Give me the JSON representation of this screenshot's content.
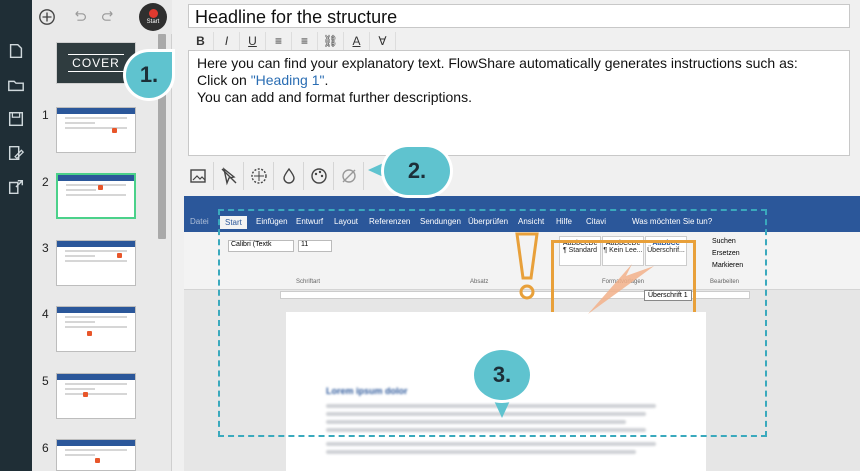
{
  "headline": {
    "value": "Headline for the structure"
  },
  "format_bar": [
    "B",
    "I",
    "U",
    "≡",
    "≡",
    "⛓",
    "A",
    "∀"
  ],
  "description": {
    "line1": "Here you can find your explanatory text. FlowShare automatically generates instructions such as:",
    "line2_prefix": "Click on ",
    "line2_link": "\"Heading 1\"",
    "line2_suffix": ".",
    "line3": "You can add and format further descriptions."
  },
  "topbar": {
    "start_label": "Start"
  },
  "thumbnails": {
    "cover_label": "COVER",
    "numbers": [
      "1",
      "2",
      "3",
      "4",
      "5",
      "6"
    ]
  },
  "callouts": {
    "one": "1.",
    "two": "2.",
    "three": "3."
  },
  "word": {
    "tabs": [
      "Datei",
      "Start",
      "Einfügen",
      "Entwurf",
      "Layout",
      "Referenzen",
      "Sendungen",
      "Überprüfen",
      "Ansicht",
      "Hilfe",
      "Citavi",
      "Was möchten Sie tun?"
    ],
    "font_name": "Calibri (Textk",
    "font_size": "11",
    "styles": [
      "AaBbCcDc",
      "AaBbCcDc",
      "AaBbCc"
    ],
    "style_labels": [
      "¶ Standard",
      "¶ Kein Lee...",
      "Überschrif..."
    ],
    "right_group": [
      "Suchen",
      "Ersetzen",
      "Markieren"
    ],
    "group_labels": [
      "Schriftart",
      "Absatz",
      "Formatvorlagen",
      "Bearbeiten"
    ],
    "tooltip": "Überschrift 1",
    "body_title": "Lorem ipsum dolor"
  },
  "colors": {
    "accent": "#5fc3cf",
    "highlight": "#e8a03a",
    "rail": "#1f2e36",
    "word_blue": "#2b579a"
  }
}
